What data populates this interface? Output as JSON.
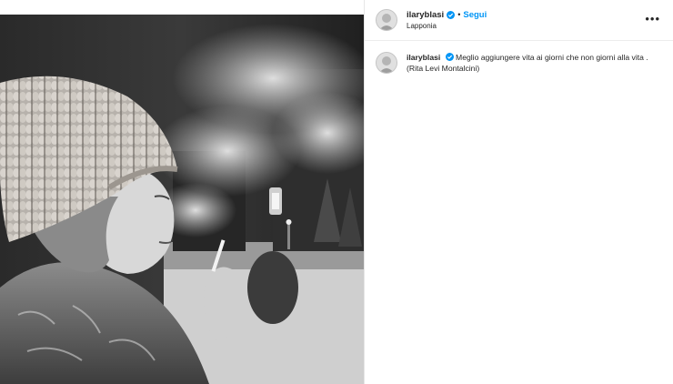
{
  "post": {
    "username": "ilaryblasi",
    "verified": true,
    "follow_label": "Segui",
    "separator": "•",
    "location": "Lapponia",
    "more_label": "•••",
    "caption_text": "Meglio aggiungere vita ai giorni che non giorni alla vita . (Rita Levi Montalcini)"
  },
  "colors": {
    "accent": "#0095f6",
    "text": "#262626",
    "verified": "#0095f6"
  },
  "icons": {
    "verified": "verified-badge-icon",
    "more": "more-options-icon"
  }
}
